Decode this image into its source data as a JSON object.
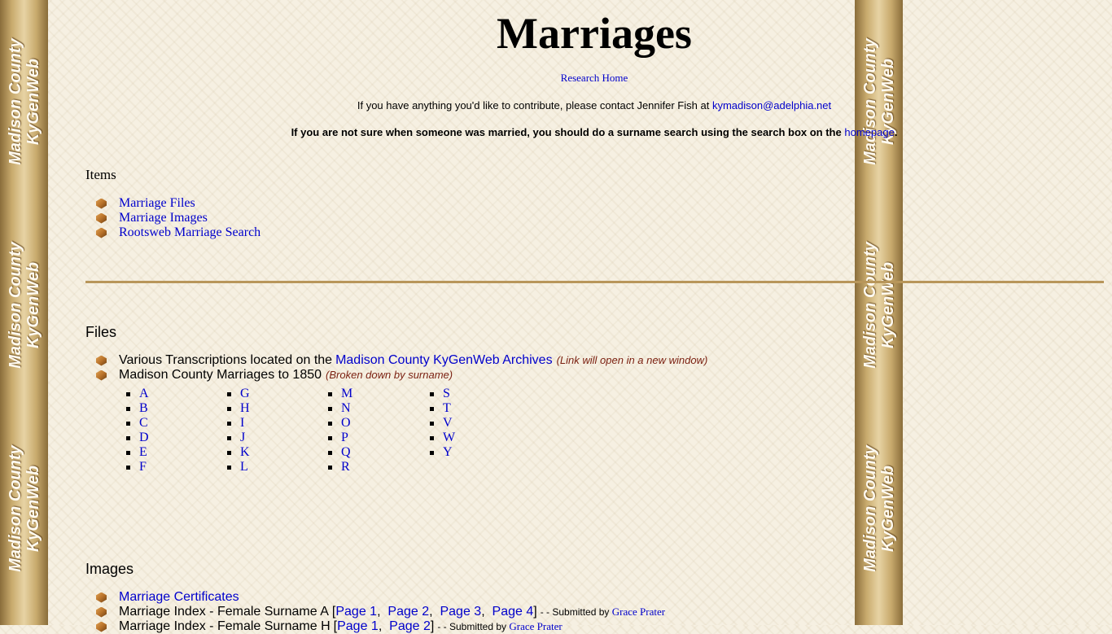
{
  "side_banner": {
    "line1": "Madison County",
    "line2": "KyGenWeb"
  },
  "page_title": "Marriages",
  "research_home": "Research Home",
  "contact": {
    "text": "If you have anything you'd like to contribute, please contact Jennifer Fish at",
    "email": "kymadison@adelphia.net"
  },
  "surname_note": {
    "text": "If you are not sure when someone was married, you should do a surname search using the search box on the",
    "link": "homepage",
    "tail": "."
  },
  "items": {
    "heading": "Items",
    "links": [
      "Marriage Files",
      "Marriage Images",
      "Rootsweb Marriage Search"
    ]
  },
  "files": {
    "heading": "Files",
    "row1": {
      "text": "Various Transcriptions located on the",
      "link": "Madison County KyGenWeb Archives",
      "note": "(Link will open in a new window)"
    },
    "row2": {
      "text": "Madison County Marriages to 1850",
      "note": "(Broken down by surname)"
    },
    "letters": [
      [
        "A",
        "B",
        "C",
        "D",
        "E",
        "F"
      ],
      [
        "G",
        "H",
        "I",
        "J",
        "K",
        "L"
      ],
      [
        "M",
        "N",
        "O",
        "P",
        "Q",
        "R"
      ],
      [
        "S",
        "T",
        "V",
        "W",
        "Y"
      ]
    ]
  },
  "images": {
    "heading": "Images",
    "row1": {
      "link": "Marriage Certificates"
    },
    "row2": {
      "text": "Marriage Index - Female Surname A",
      "open": "[",
      "pages": [
        "Page 1",
        "Page 2",
        "Page 3",
        "Page 4"
      ],
      "close": "]",
      "submitted": "- - Submitted by",
      "submitter": "Grace Prater"
    },
    "row3": {
      "text": "Marriage Index - Female Surname H",
      "open": "[",
      "pages": [
        "Page 1",
        "Page 2"
      ],
      "close": "]",
      "submitted": "- - Submitted by",
      "submitter": "Grace Prater"
    }
  }
}
